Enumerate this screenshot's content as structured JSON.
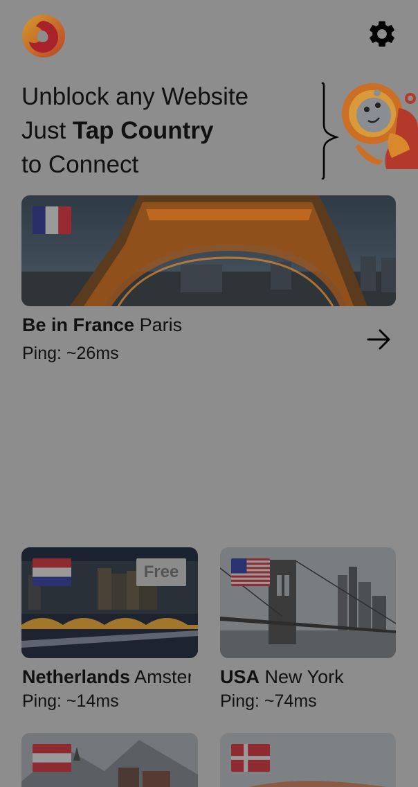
{
  "header": {
    "logo_icon": "app-logo-icon",
    "settings_icon": "gear-icon"
  },
  "headline": {
    "line1": "Unblock any Website",
    "line2_prefix": "Just ",
    "line2_bold": "Tap Country",
    "line3": "to Connect"
  },
  "featured": {
    "country": "Be in France",
    "city": " Paris",
    "ping": "Ping: ~26ms",
    "flag": "france-flag-icon"
  },
  "servers": [
    {
      "country": "Netherlands",
      "city": " Amsterdam",
      "ping": "Ping: ~14ms",
      "badge": "Free",
      "flag": "netherlands-flag-icon"
    },
    {
      "country": "USA",
      "city": " New York",
      "ping": "Ping: ~74ms",
      "flag": "usa-flag-icon"
    },
    {
      "flag": "austria-flag-icon"
    },
    {
      "flag": "denmark-flag-icon"
    }
  ],
  "colors": {
    "background": "#8d8d8d",
    "text": "#111111",
    "logo_orange": "#e0a02a",
    "logo_red": "#b8232a"
  }
}
